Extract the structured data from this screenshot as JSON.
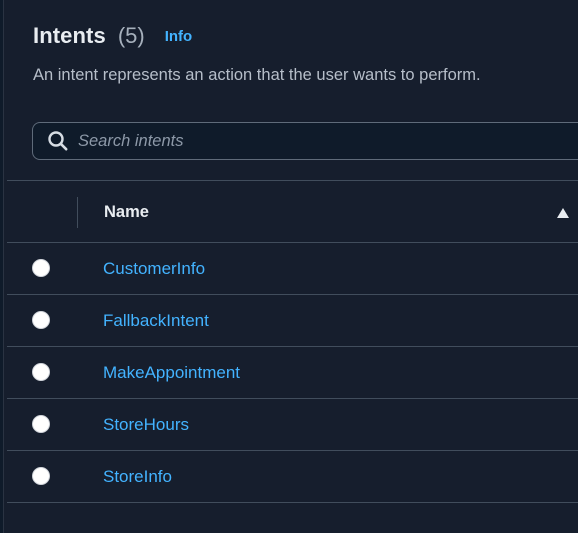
{
  "header": {
    "title": "Intents",
    "count": "(5)",
    "info_label": "Info"
  },
  "description": "An intent represents an action that the user wants to perform.",
  "search": {
    "placeholder": "Search intents",
    "value": ""
  },
  "table": {
    "columns": [
      {
        "label": "Name",
        "sort": "ascending"
      }
    ],
    "rows": [
      {
        "name": "CustomerInfo",
        "selected": false
      },
      {
        "name": "FallbackIntent",
        "selected": false
      },
      {
        "name": "MakeAppointment",
        "selected": false
      },
      {
        "name": "StoreHours",
        "selected": false
      },
      {
        "name": "StoreInfo",
        "selected": false
      }
    ]
  },
  "colors": {
    "background": "#161e2d",
    "link": "#43b3ff",
    "text_primary": "#e9edf1",
    "text_secondary": "#b6bec9",
    "border": "#414d5c"
  },
  "icons": {
    "search": "search-icon",
    "sort": "sort-ascending-icon",
    "radio": "radio-button-unselected"
  }
}
